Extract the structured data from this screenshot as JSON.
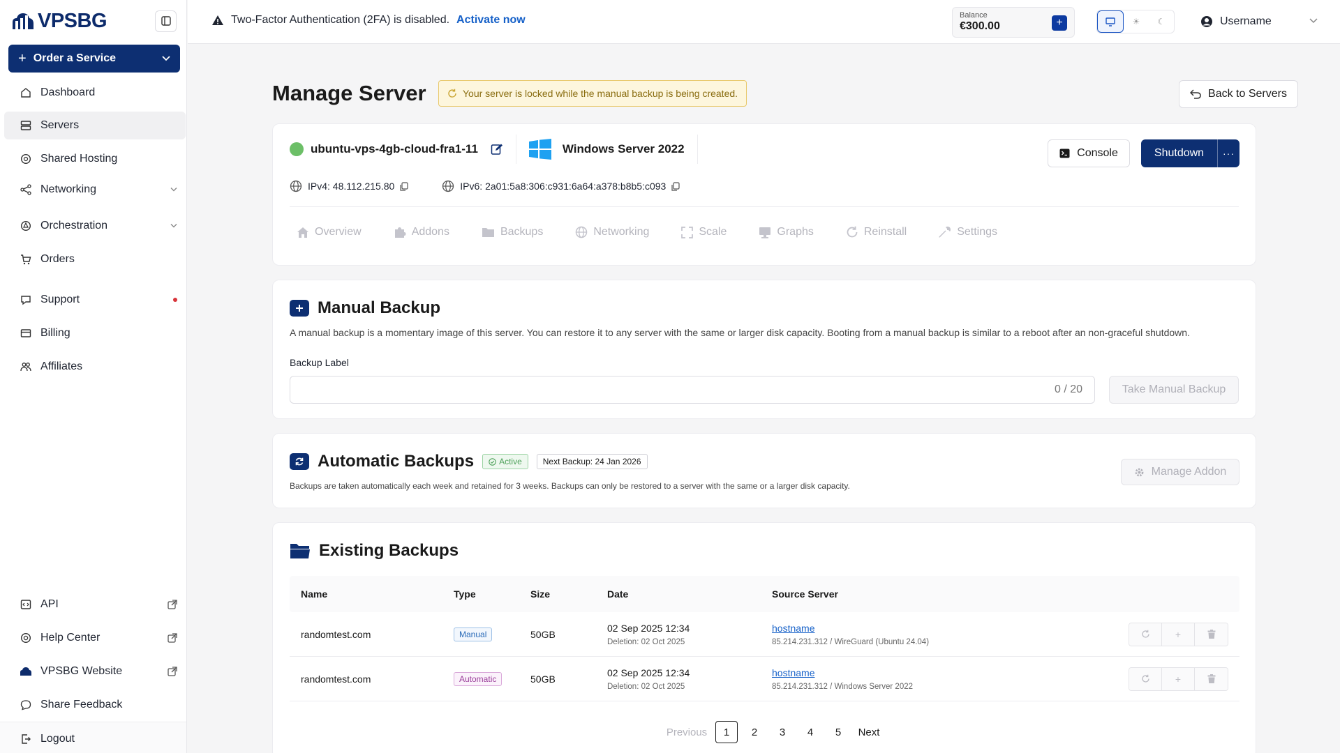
{
  "brand": {
    "name": "VPSBG"
  },
  "sidebar": {
    "order_label": "Order a Service",
    "items": [
      {
        "label": "Dashboard",
        "icon": "home-icon"
      },
      {
        "label": "Servers",
        "icon": "servers-icon",
        "active": true
      },
      {
        "label": "Shared Hosting",
        "icon": "shared-hosting-icon"
      },
      {
        "label": "Networking",
        "icon": "networking-icon"
      },
      {
        "label": "Orchestration",
        "icon": "orchestration-icon"
      },
      {
        "label": "Orders",
        "icon": "cart-icon"
      },
      {
        "label": "Support",
        "icon": "support-icon"
      },
      {
        "label": "Billing",
        "icon": "billing-icon"
      },
      {
        "label": "Affiliates",
        "icon": "affiliates-icon"
      }
    ],
    "bottom_items": [
      {
        "label": "API",
        "icon": "api-icon"
      },
      {
        "label": "Help Center",
        "icon": "help-icon"
      },
      {
        "label": "VPSBG Website",
        "icon": "website-icon"
      },
      {
        "label": "Share Feedback",
        "icon": "feedback-icon"
      },
      {
        "label": "Logout",
        "icon": "logout-icon"
      }
    ]
  },
  "topbar": {
    "twofa_text": "Two-Factor Authentication (2FA) is disabled.",
    "twofa_link": "Activate now",
    "balance_label": "Balance",
    "balance_value": "€300.00",
    "username": "Username"
  },
  "page": {
    "title": "Manage Server",
    "lock_notice": "Your server is locked while the manual backup is being created.",
    "back_label": "Back to Servers"
  },
  "server": {
    "hostname": "ubuntu-vps-4gb-cloud-fra1-11",
    "os": "Windows Server 2022",
    "ipv4": "IPv4: 48.112.215.80",
    "ipv6": "IPv6: 2a01:5a8:306:c931:6a64:a378:b8b5:c093",
    "console_label": "Console",
    "shutdown_label": "Shutdown",
    "more_label": "···",
    "status_color": "#6cbf67",
    "tabs": [
      "Overview",
      "Addons",
      "Backups",
      "Networking",
      "Scale",
      "Graphs",
      "Reinstall",
      "Settings"
    ]
  },
  "manual_backup": {
    "title": "Manual Backup",
    "description": "A manual backup is a momentary image of this server. You can restore it to any server with the same or larger disk capacity. Booting from a manual backup is similar to a reboot after an non-graceful shutdown.",
    "field_label": "Backup Label",
    "input_value": "",
    "counter": "0 / 20",
    "button_label": "Take Manual Backup"
  },
  "automatic_backups": {
    "title": "Automatic Backups",
    "status_badge": "Active",
    "next_backup": "Next Backup: 24 Jan 2026",
    "description": "Backups are taken automatically each week and retained for 3 weeks. Backups can only be restored to a server with the same or a larger disk capacity.",
    "manage_label": "Manage Addon"
  },
  "existing_backups": {
    "title": "Existing Backups",
    "columns": [
      "Name",
      "Type",
      "Size",
      "Date",
      "Source Server"
    ],
    "rows": [
      {
        "name": "randomtest.com",
        "type": "Manual",
        "size": "50GB",
        "date": "02 Sep 2025 12:34",
        "deletion": "Deletion: 02 Oct 2025",
        "source_host": "hostname",
        "source_detail": "85.214.231.312 / WireGuard (Ubuntu 24.04)"
      },
      {
        "name": "randomtest.com",
        "type": "Automatic",
        "size": "50GB",
        "date": "02 Sep 2025 12:34",
        "deletion": "Deletion: 02 Oct 2025",
        "source_host": "hostname",
        "source_detail": "85.214.231.312 / Windows Server 2022"
      }
    ],
    "pagination": {
      "prev": "Previous",
      "pages": [
        "1",
        "2",
        "3",
        "4",
        "5"
      ],
      "current": "1",
      "next": "Next"
    }
  },
  "colors": {
    "brand_navy": "#0d2f72",
    "link_blue": "#1560c8",
    "warning_bg": "#fdf6dd"
  }
}
